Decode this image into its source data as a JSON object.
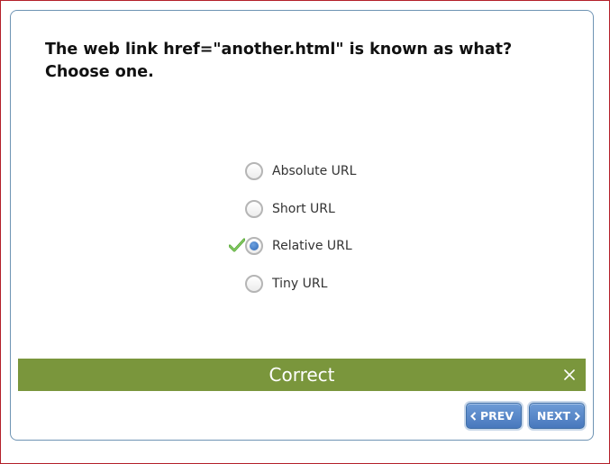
{
  "question": {
    "line1": "The web link href=\"another.html\" is known as what?",
    "line2": "Choose one."
  },
  "options": [
    {
      "label": "Absolute URL",
      "selected": false
    },
    {
      "label": "Short URL",
      "selected": false
    },
    {
      "label": "Relative URL",
      "selected": true,
      "correct_mark": "check-icon"
    },
    {
      "label": "Tiny URL",
      "selected": false
    }
  ],
  "feedback": {
    "text": "Correct",
    "color": "#7a963c"
  },
  "navigation": {
    "prev_label": "PREV",
    "next_label": "NEXT",
    "accent": "#4878bd"
  }
}
